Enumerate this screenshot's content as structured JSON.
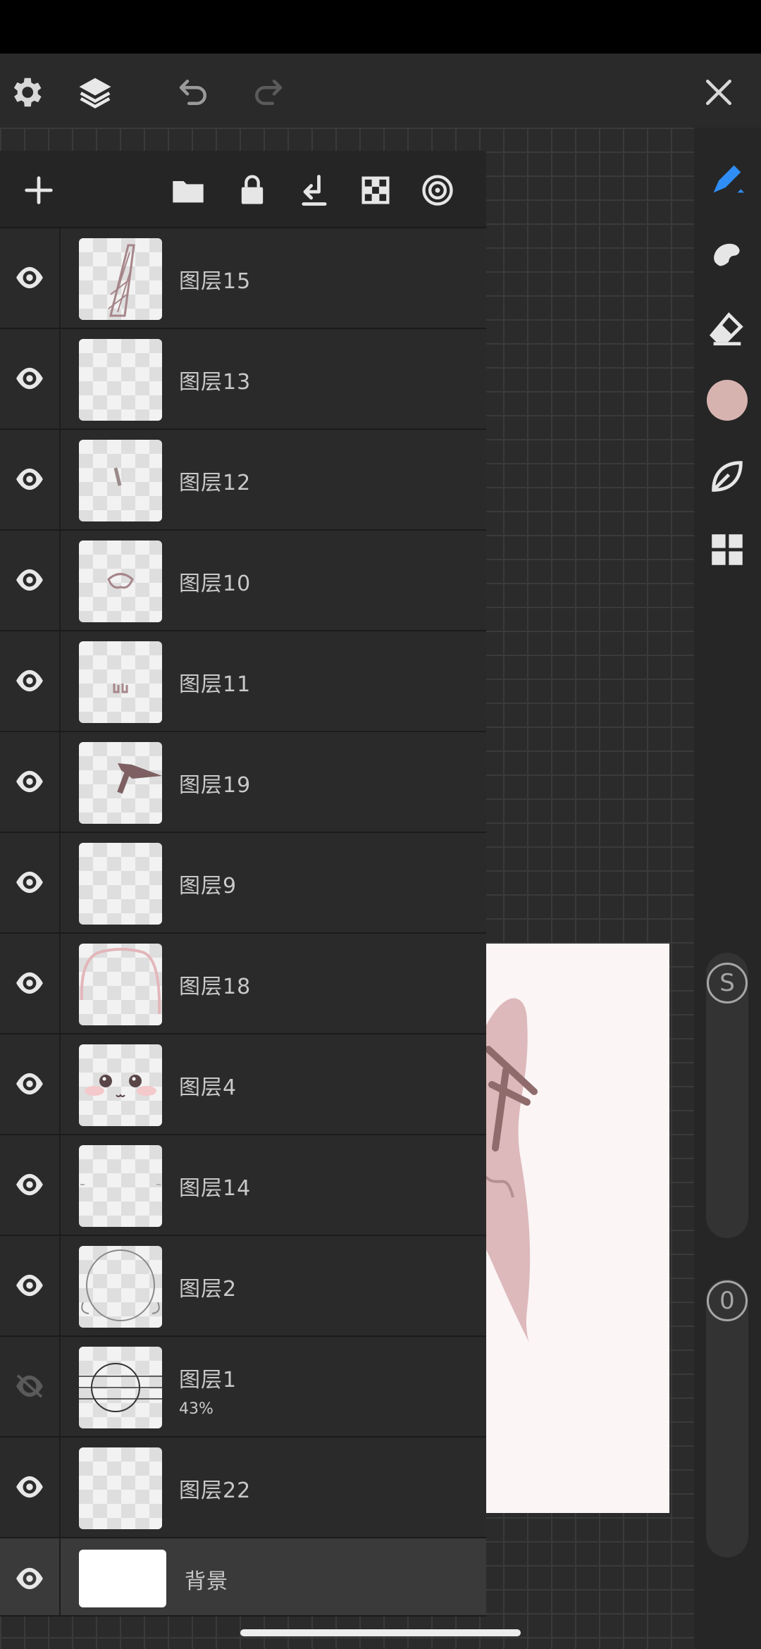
{
  "toolbar": {
    "icons": [
      "gear-icon",
      "layers-icon",
      "undo-icon",
      "redo-icon",
      "close-icon"
    ]
  },
  "layers_panel": {
    "header_icons": [
      "add-icon",
      "folder-icon",
      "lock-icon",
      "merge-down-icon",
      "checkerboard-icon",
      "clipping-mask-icon"
    ],
    "layers": [
      {
        "name": "图层15",
        "visible": true
      },
      {
        "name": "图层13",
        "visible": true
      },
      {
        "name": "图层12",
        "visible": true
      },
      {
        "name": "图层10",
        "visible": true
      },
      {
        "name": "图层11",
        "visible": true
      },
      {
        "name": "图层19",
        "visible": true
      },
      {
        "name": "图层9",
        "visible": true
      },
      {
        "name": "图层18",
        "visible": true
      },
      {
        "name": "图层4",
        "visible": true
      },
      {
        "name": "图层14",
        "visible": true
      },
      {
        "name": "图层2",
        "visible": true
      },
      {
        "name": "图层1",
        "visible": false,
        "opacity": "43%"
      },
      {
        "name": "图层22",
        "visible": true
      },
      {
        "name": "背景",
        "visible": true
      }
    ]
  },
  "right_rail": {
    "tools": [
      "pen-icon",
      "smudge-icon",
      "eraser-icon",
      "color-swatch",
      "leaf-icon",
      "grid-icon"
    ],
    "current_color": "#d7b3b0",
    "size_badge": "S",
    "opacity_badge": "0"
  }
}
